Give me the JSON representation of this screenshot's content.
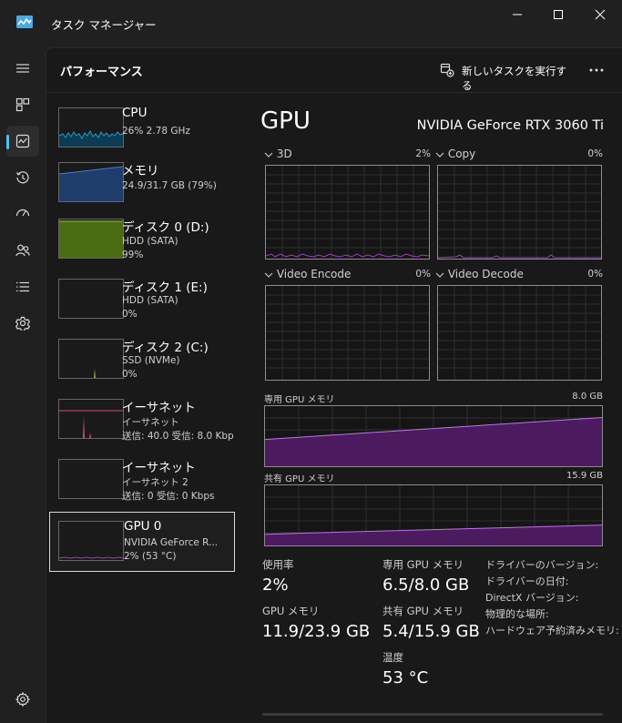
{
  "window": {
    "title": "タスク マネージャー"
  },
  "page": {
    "title": "パフォーマンス",
    "run_task_label": "新しいタスクを実行する"
  },
  "nav": [
    {
      "icon": "hamburger-menu-icon"
    },
    {
      "icon": "processes-icon"
    },
    {
      "icon": "performance-icon",
      "active": true
    },
    {
      "icon": "app-history-icon"
    },
    {
      "icon": "startup-apps-icon"
    },
    {
      "icon": "users-icon"
    },
    {
      "icon": "details-icon"
    },
    {
      "icon": "services-icon"
    },
    {
      "icon": "settings-icon"
    }
  ],
  "devices": [
    {
      "name": "CPU",
      "sub1": "26%  2.78 GHz",
      "sub2": "",
      "sub3": "",
      "graph_color": "#17a2d4"
    },
    {
      "name": "メモリ",
      "sub1": "24.9/31.7 GB (79%)",
      "sub2": "",
      "sub3": "",
      "graph_color": "#3c7fd8"
    },
    {
      "name": "ディスク 0 (D:)",
      "sub1": "HDD (SATA)",
      "sub2": "99%",
      "sub3": "",
      "graph_color": "#7fb51c"
    },
    {
      "name": "ディスク 1 (E:)",
      "sub1": "HDD (SATA)",
      "sub2": "0%",
      "sub3": "",
      "graph_color": "#7fb51c"
    },
    {
      "name": "ディスク 2 (C:)",
      "sub1": "SSD (NVMe)",
      "sub2": "0%",
      "sub3": "",
      "graph_color": "#7fb51c"
    },
    {
      "name": "イーサネット",
      "sub1": "イーサネット",
      "sub2": "送信: 40.0  受信: 8.0 Kbp",
      "sub3": "",
      "graph_color": "#c94f8b"
    },
    {
      "name": "イーサネット",
      "sub1": "イーサネット 2",
      "sub2": "送信: 0  受信: 0 Kbps",
      "sub3": "",
      "graph_color": "#c94f8b"
    },
    {
      "name": "GPU 0",
      "sub1": "NVIDIA GeForce R...",
      "sub2": "2%  (53 °C)",
      "sub3": "",
      "graph_color": "#9b3fc4",
      "selected": true
    }
  ],
  "gpu": {
    "title": "GPU",
    "model": "NVIDIA GeForce RTX 3060 Ti",
    "engines": [
      {
        "label": "3D",
        "pct": "2%"
      },
      {
        "label": "Copy",
        "pct": "0%"
      },
      {
        "label": "Video Encode",
        "pct": "0%"
      },
      {
        "label": "Video Decode",
        "pct": "0%"
      }
    ],
    "dedicated_memory": {
      "label": "専用 GPU メモリ",
      "max": "8.0 GB",
      "used_fraction": 0.81
    },
    "shared_memory": {
      "label": "共有 GPU メモリ",
      "max": "15.9 GB",
      "used_fraction": 0.34
    },
    "stats": {
      "utilization_label": "使用率",
      "utilization_value": "2%",
      "dedicated_label": "専用 GPU メモリ",
      "dedicated_value": "6.5/8.0 GB",
      "gpu_memory_label": "GPU メモリ",
      "gpu_memory_value": "11.9/23.9 GB",
      "shared_label": "共有 GPU メモリ",
      "shared_value": "5.4/15.9 GB",
      "temp_label": "温度",
      "temp_value": "53 °C"
    },
    "properties": [
      "ドライバーのバージョン:",
      "ドライバーの日付:",
      "DirectX バージョン:",
      "物理的な場所:",
      "ハードウェア予約済みメモリ:"
    ]
  },
  "colors": {
    "gpu_line": "#9b3fc4",
    "gpu_fill": "#4b1a5f",
    "cpu_line": "#17a2d4",
    "memory_line": "#3c7fd8",
    "disk_line": "#7fb51c",
    "network_line": "#c94f8b"
  }
}
